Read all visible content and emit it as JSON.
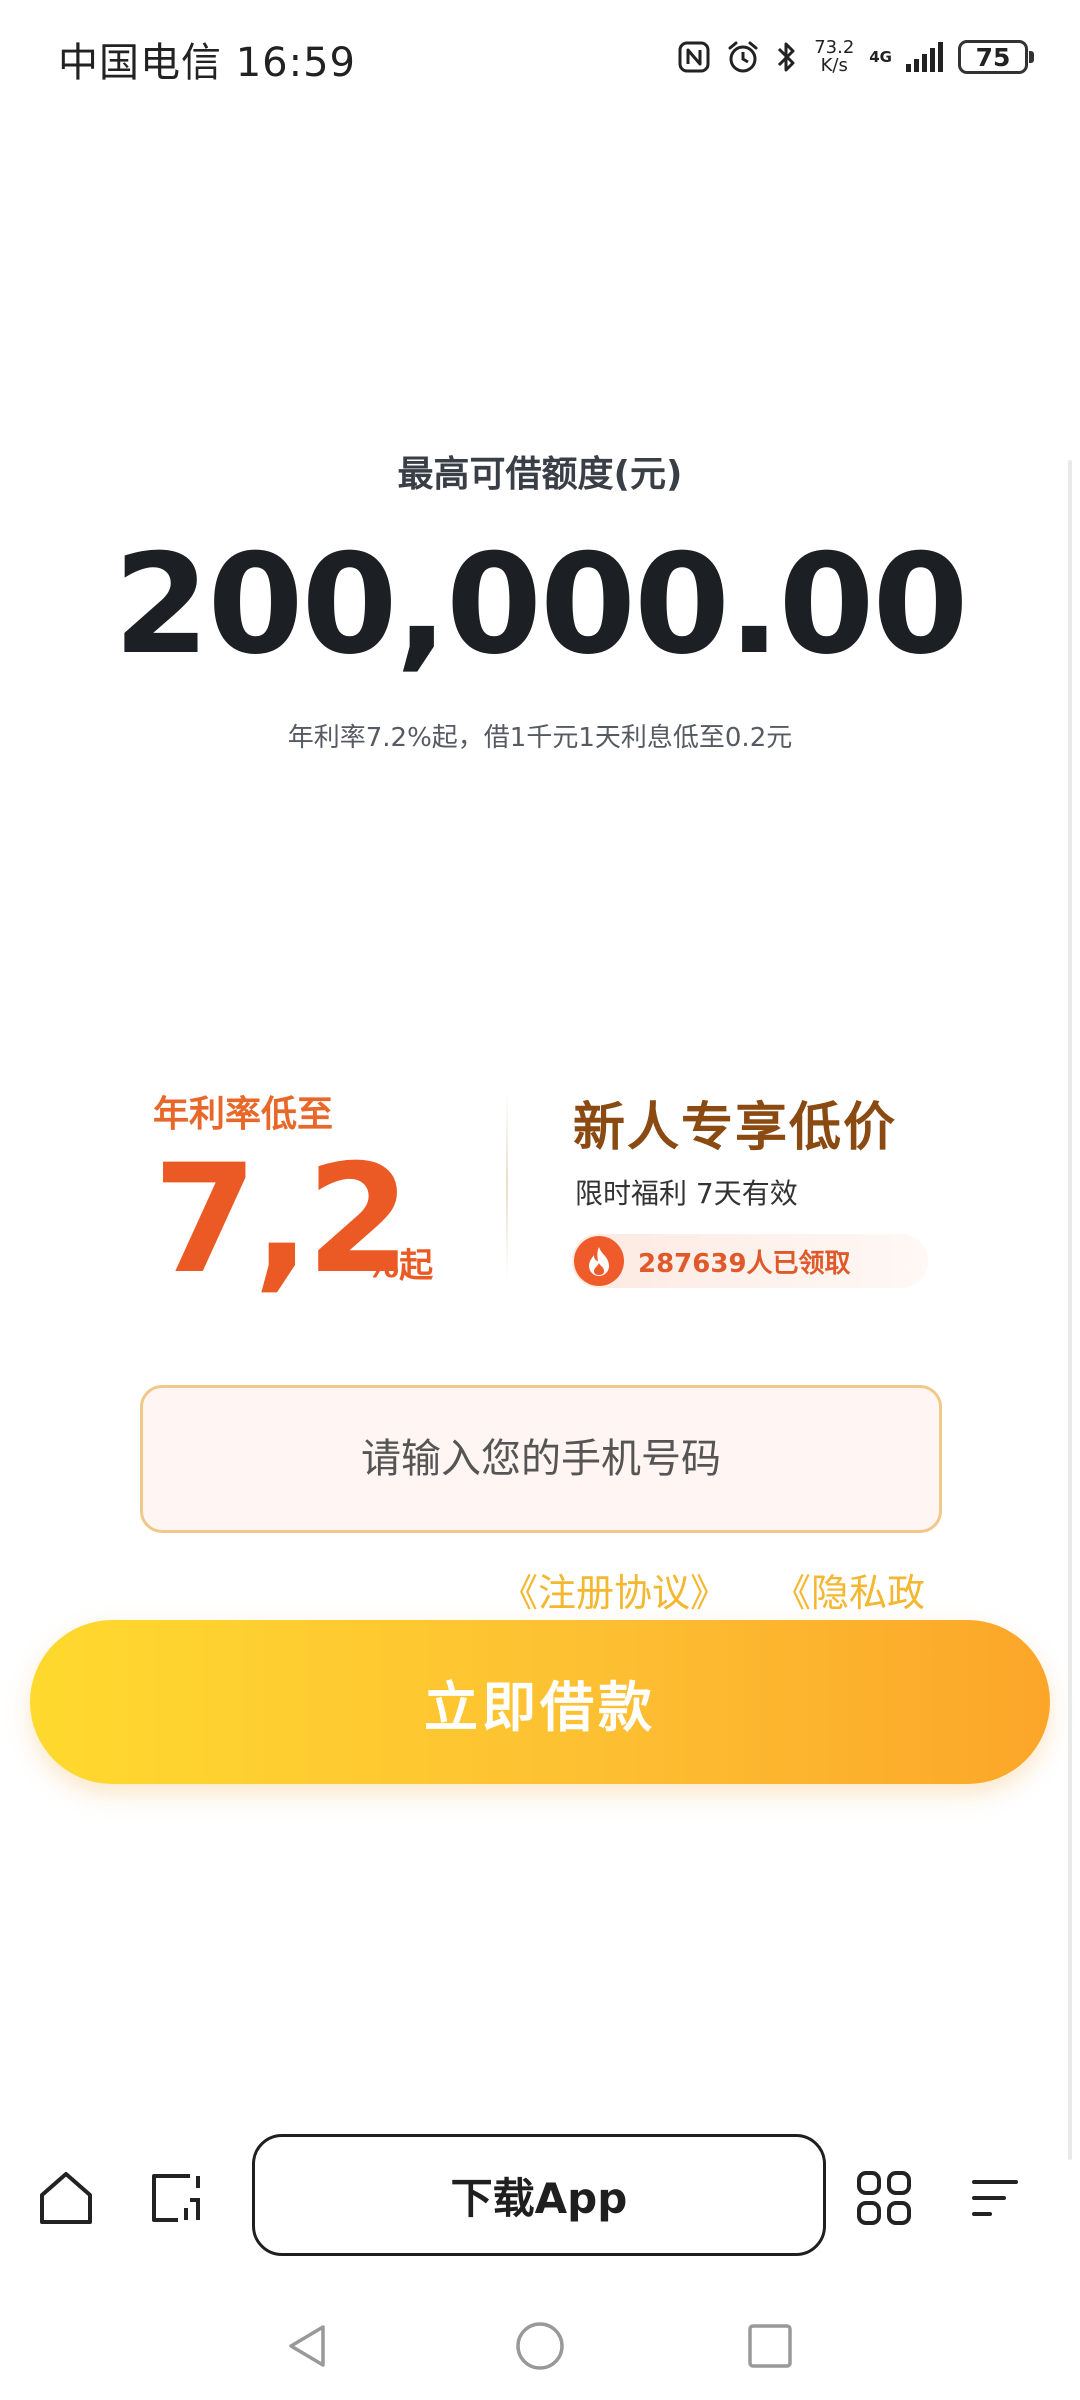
{
  "status_bar": {
    "carrier_time": "中国电信 16:59",
    "net_speed_value": "73.2",
    "net_speed_unit": "K/s",
    "net_type": "4G",
    "battery": "75"
  },
  "hero": {
    "limit_label": "最高可借额度(元)",
    "limit_amount": "200,000.00",
    "rate_desc": "年利率7.2%起，借1千元1天利息低至0.2元"
  },
  "promo": {
    "rate_label": "年利率低至",
    "rate_value": "7,2",
    "rate_suffix": "%起",
    "title": "新人专享低价",
    "subtitle": "限时福利 7天有效",
    "claim_text": "287639人已领取"
  },
  "form": {
    "phone_placeholder": "请输入您的手机号码",
    "register_link": "《注册协议》",
    "privacy_link": "《隐私政",
    "borrow_button": "立即借款"
  },
  "browser_bar": {
    "download_label": "下载App"
  },
  "colors": {
    "accent_orange": "#eb5a24",
    "promo_brown": "#8a4a12",
    "button_yellow": "#fdc032",
    "link_yellow": "#f4b730"
  }
}
